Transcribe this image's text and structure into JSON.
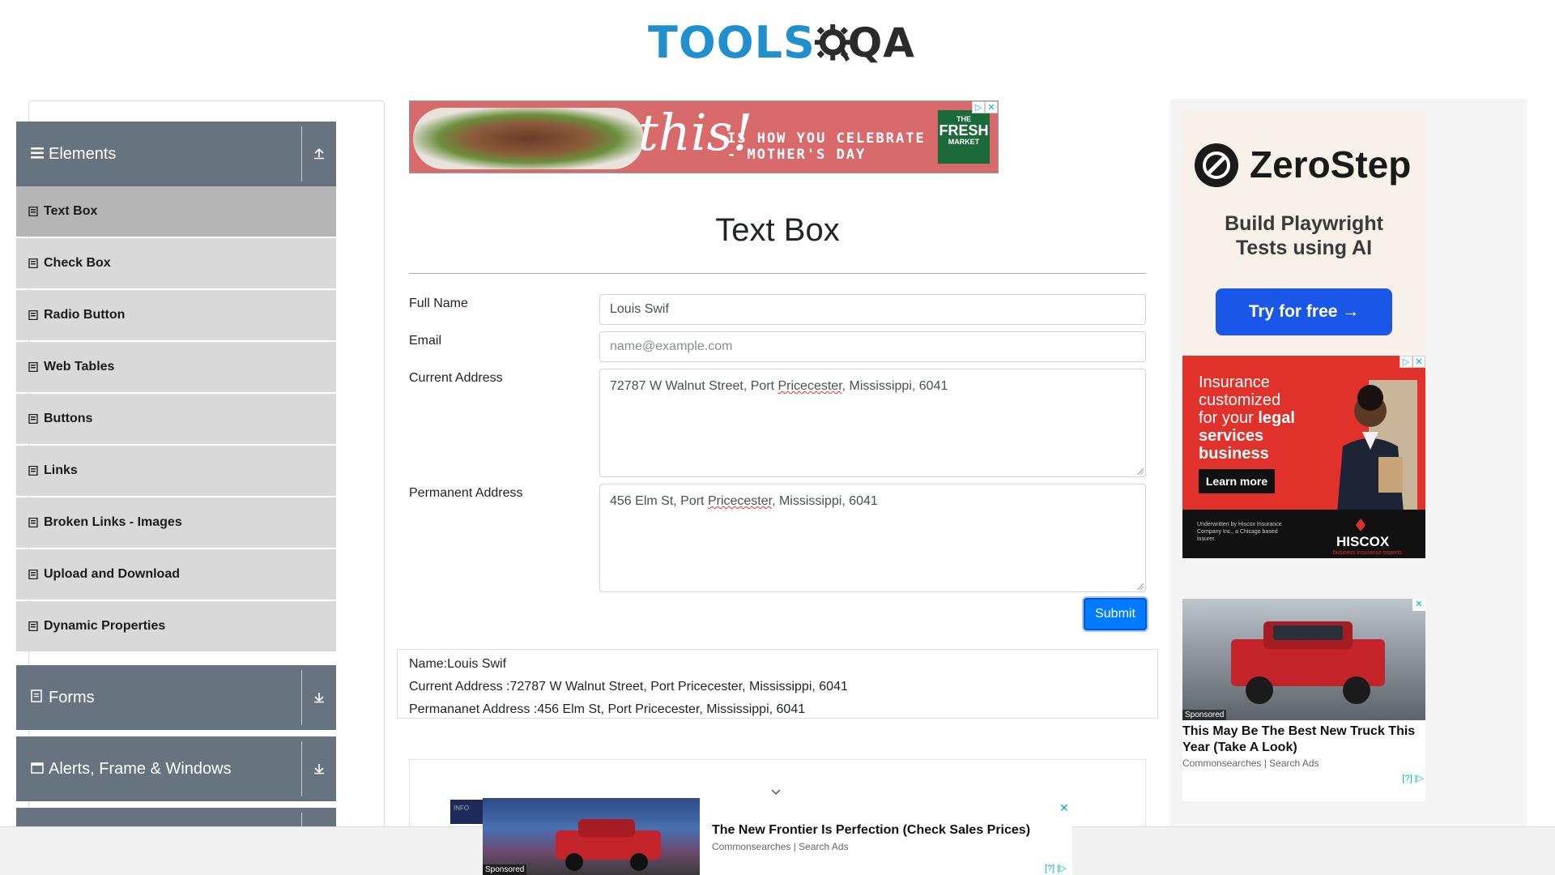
{
  "logo": {
    "part1": "TOOLS",
    "part2": "QA"
  },
  "sidebar": {
    "groups": [
      {
        "label": "Elements",
        "icon": "hamburger-icon",
        "expanded": true
      },
      {
        "label": "Forms",
        "icon": "form-icon",
        "expanded": false
      },
      {
        "label": "Alerts, Frame & Windows",
        "icon": "window-icon",
        "expanded": false
      }
    ],
    "items": [
      {
        "label": "Text Box",
        "active": true
      },
      {
        "label": "Check Box"
      },
      {
        "label": "Radio Button"
      },
      {
        "label": "Web Tables"
      },
      {
        "label": "Buttons"
      },
      {
        "label": "Links"
      },
      {
        "label": "Broken Links - Images"
      },
      {
        "label": "Upload and Download"
      },
      {
        "label": "Dynamic Properties"
      }
    ]
  },
  "banner": {
    "headline": "this!",
    "line1": "IS HOW YOU CELEBRATE",
    "line2": "- MOTHER'S DAY",
    "logo_small": "THE",
    "logo_big": "FRESH",
    "logo_bottom": "MARKET"
  },
  "main": {
    "title": "Text Box",
    "form": {
      "full_name_label": "Full Name",
      "full_name_value": "Louis Swif",
      "email_label": "Email",
      "email_placeholder": "name@example.com",
      "current_address_label": "Current Address",
      "current_address_value_a": "72787 W Walnut Street, Port ",
      "current_address_value_b": "Pricecester",
      "current_address_value_c": ", Mississippi, 6041",
      "permanent_address_label": "Permanent Address",
      "permanent_address_value_a": "456 Elm St, Port ",
      "permanent_address_value_b": "Pricecester",
      "permanent_address_value_c": ", Mississippi, 6041",
      "submit_label": "Submit"
    },
    "output": {
      "name": "Name:Louis Swif",
      "current_address": "Current Address :72787 W Walnut Street, Port Pricecester, Mississippi, 6041",
      "permanent_address": "Permananet Address :456 Elm St, Port Pricecester, Mississippi, 6041"
    }
  },
  "ads": {
    "zerostep": {
      "brand": "ZeroStep",
      "tagline1": "Build Playwright",
      "tagline2": "Tests using AI",
      "cta": "Try for free →"
    },
    "hiscox": {
      "line1": "Insurance",
      "line2": "customized",
      "line3a": "for your ",
      "line3b": "legal",
      "line4": "services",
      "line5": "business",
      "cta": "Learn more",
      "fine": "Underwritten by Hiscox Insurance Company Inc., a Chicago based insurer.",
      "brand": "HISCOX",
      "brand_sub": "business insurance experts"
    },
    "truck": {
      "sponsored": "Sponsored",
      "title": "This May Be The Best New Truck This Year (Take A Look)",
      "source": "Commonsearches | Search Ads",
      "info": "[?] |▷"
    },
    "sticky": {
      "sponsored": "Sponsored",
      "title": "The New Frontier Is Perfection (Check Sales Prices)",
      "source": "Commonsearches | Search Ads",
      "info": "[?] |▷",
      "close": "✕",
      "stripe_text": "INFO"
    },
    "close_glyph": "✕",
    "choice_glyph": "▷"
  }
}
